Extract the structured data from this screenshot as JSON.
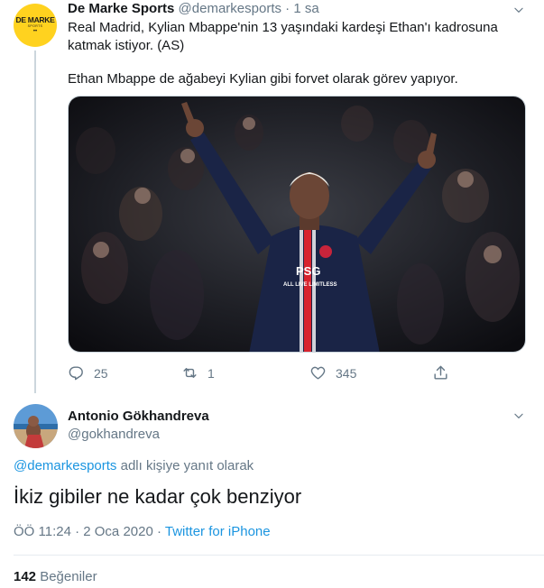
{
  "original_tweet": {
    "author_name": "De Marke Sports",
    "author_handle": "@demarkesports",
    "time": "· 1 sa",
    "avatar": {
      "logo_text": "DE MARKE",
      "logo_sub": "SPORTS",
      "logo_dots": "••"
    },
    "text_line1": "Real Madrid, Kylian Mbappe'nin 13 yaşındaki kardeşi Ethan'ı kadrosuna",
    "text_line2": "katmak istiyor. (AS)",
    "text_line3": "Ethan Mbappe de ağabeyi Kylian gibi forvet olarak görev yapıyor.",
    "photo": {
      "jersey_text": "PSG",
      "sponsor_text": "ALL LIVE LIMITLESS"
    },
    "actions": {
      "reply_count": "25",
      "retweet_count": "1",
      "like_count": "345"
    }
  },
  "reply_tweet": {
    "author_name": "Antonio Gökhandreva",
    "author_handle": "@gokhandreva",
    "reply_to_mention": "@demarkesports",
    "reply_to_suffix": " adlı kişiye yanıt olarak",
    "text": "İkiz gibiler ne kadar çok benziyor",
    "timestamp": "ÖÖ 11:24 · 2 Oca 2020 · ",
    "source": "Twitter for iPhone",
    "likes_count": "142",
    "likes_label": " Beğeniler"
  },
  "colors": {
    "link": "#1b95e0",
    "secondary_text": "#657786",
    "primary_text": "#14171a",
    "avatar_yellow": "#ffd21f",
    "divider": "#e6ecf0"
  }
}
